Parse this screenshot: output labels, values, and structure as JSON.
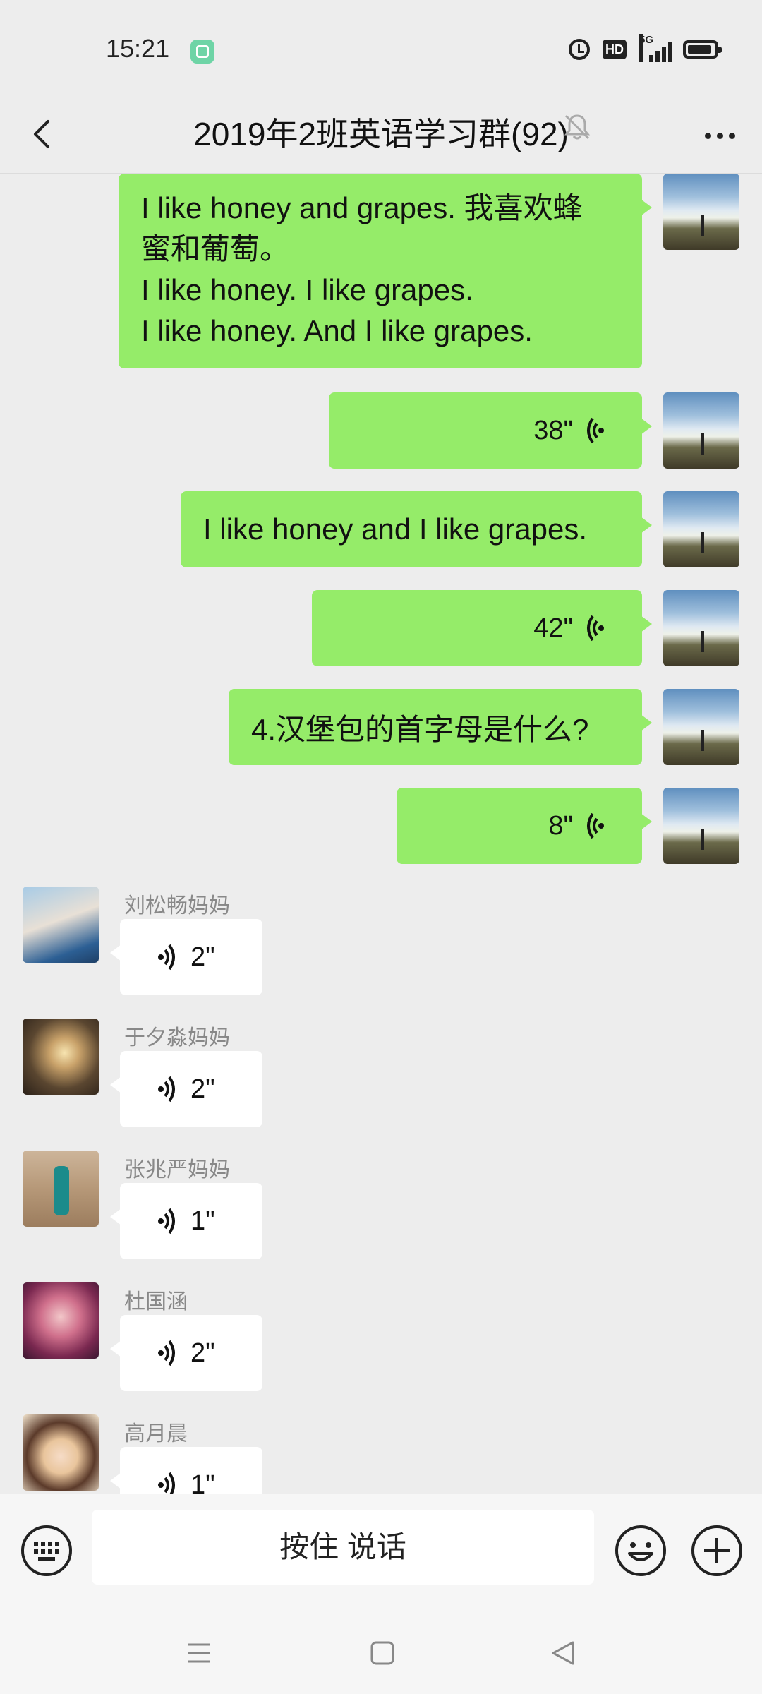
{
  "status_bar": {
    "time": "15:21",
    "network": "5G"
  },
  "header": {
    "title": "2019年2班英语学习群(92)"
  },
  "messages": [
    {
      "kind": "text",
      "side": "right",
      "lines": [
        "I like honey and grapes. 我喜欢蜂",
        "蜜和葡萄。",
        "I like honey.   I like grapes.",
        "I like honey. And I like grapes."
      ]
    },
    {
      "kind": "voice",
      "side": "right",
      "duration": "38\""
    },
    {
      "kind": "text",
      "side": "right",
      "lines": [
        "I like honey and I like grapes."
      ]
    },
    {
      "kind": "voice",
      "side": "right",
      "duration": "42\""
    },
    {
      "kind": "text",
      "side": "right",
      "lines": [
        "4.汉堡包的首字母是什么?"
      ]
    },
    {
      "kind": "voice",
      "side": "right",
      "duration": "8\""
    },
    {
      "kind": "voice",
      "side": "left",
      "sender": "刘松畅妈妈",
      "duration": "2\""
    },
    {
      "kind": "voice",
      "side": "left",
      "sender": "于夕淼妈妈",
      "duration": "2\""
    },
    {
      "kind": "voice",
      "side": "left",
      "sender": "张兆严妈妈",
      "duration": "1\""
    },
    {
      "kind": "voice",
      "side": "left",
      "sender": "杜国涵",
      "duration": "2\""
    },
    {
      "kind": "voice",
      "side": "left",
      "sender": "高月晨",
      "duration": "1\""
    }
  ],
  "input_bar": {
    "talk_label": "按住 说话"
  },
  "colors": {
    "bubble_green": "#95ec69",
    "background": "#ededed"
  },
  "icons": [
    "back-icon",
    "mute-icon",
    "more-icon",
    "voice-icon",
    "keyboard-icon",
    "emoji-icon",
    "plus-icon"
  ]
}
